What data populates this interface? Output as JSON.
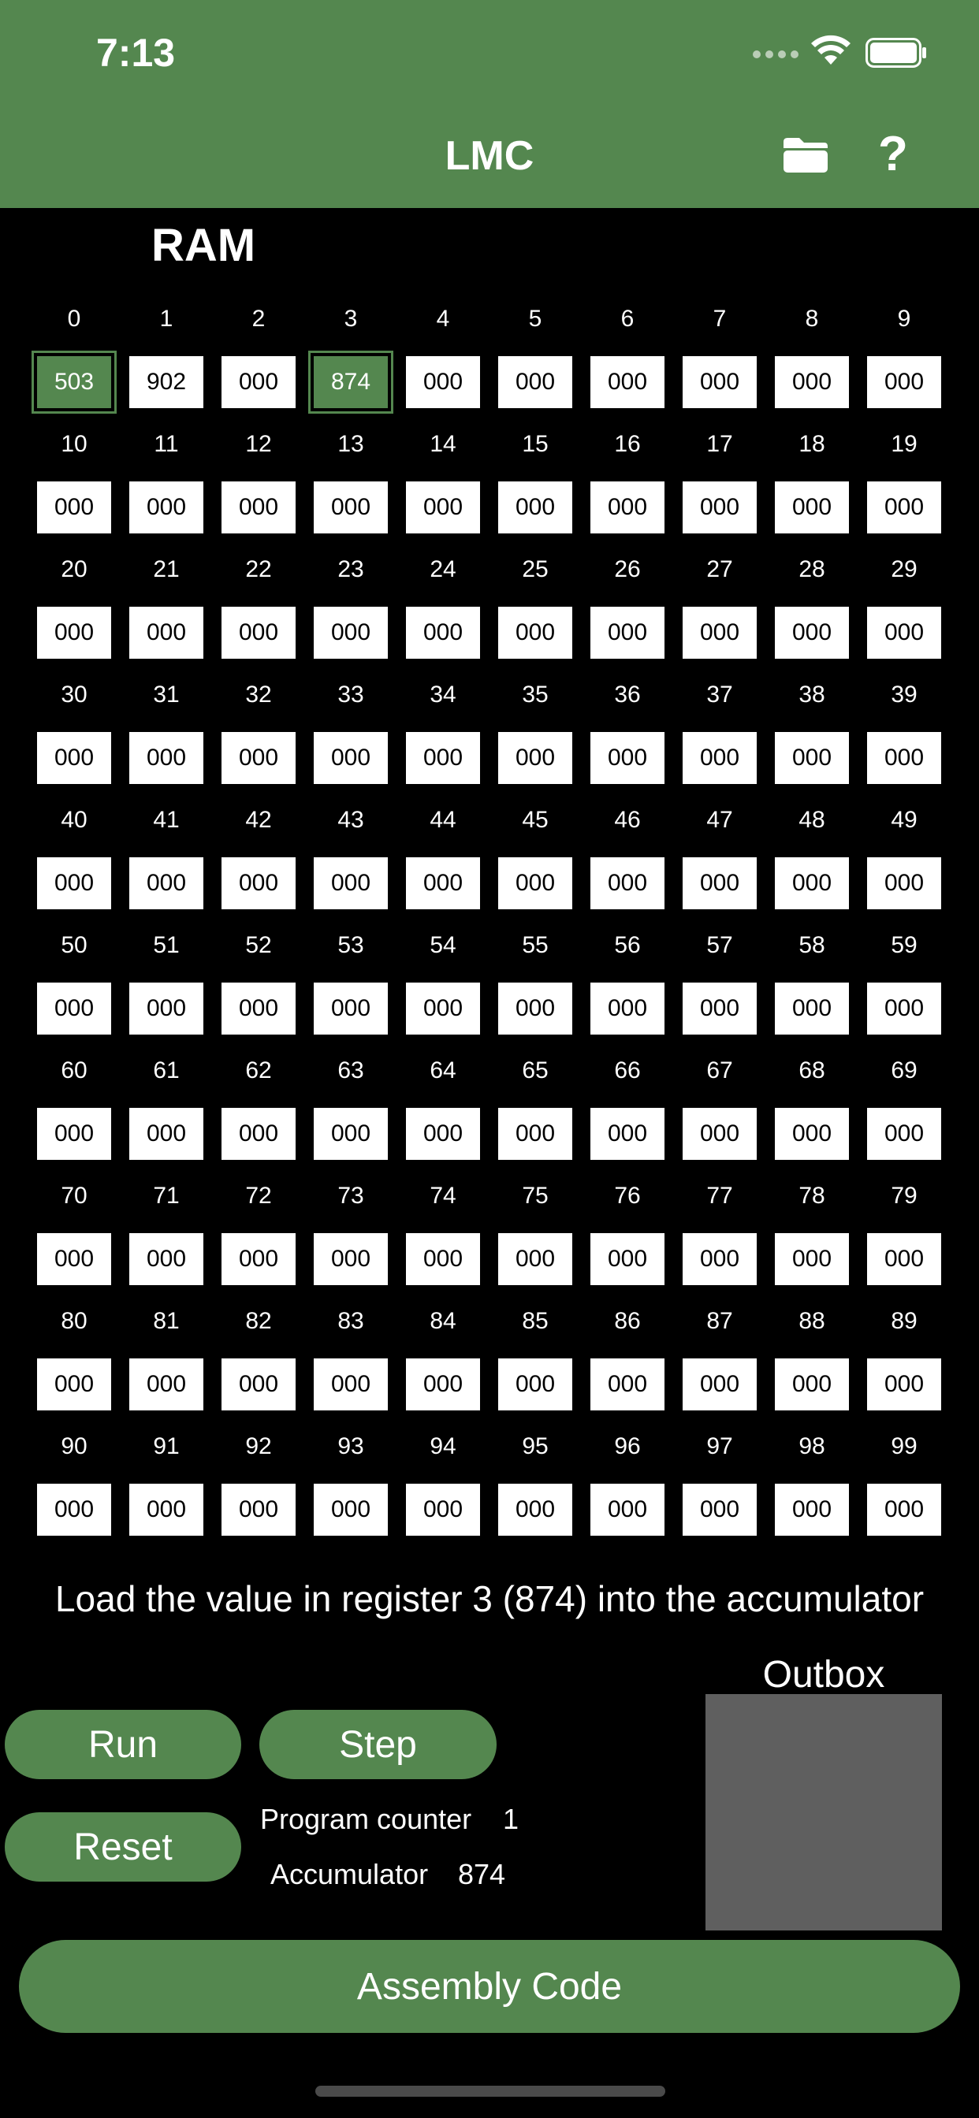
{
  "status_bar": {
    "time": "7:13"
  },
  "nav": {
    "title": "LMC",
    "help": "?"
  },
  "ram": {
    "title": "RAM",
    "cells": [
      {
        "addr": "0",
        "value": "503",
        "active": true
      },
      {
        "addr": "1",
        "value": "902",
        "active": false
      },
      {
        "addr": "2",
        "value": "000",
        "active": false
      },
      {
        "addr": "3",
        "value": "874",
        "active": true
      },
      {
        "addr": "4",
        "value": "000",
        "active": false
      },
      {
        "addr": "5",
        "value": "000",
        "active": false
      },
      {
        "addr": "6",
        "value": "000",
        "active": false
      },
      {
        "addr": "7",
        "value": "000",
        "active": false
      },
      {
        "addr": "8",
        "value": "000",
        "active": false
      },
      {
        "addr": "9",
        "value": "000",
        "active": false
      },
      {
        "addr": "10",
        "value": "000",
        "active": false
      },
      {
        "addr": "11",
        "value": "000",
        "active": false
      },
      {
        "addr": "12",
        "value": "000",
        "active": false
      },
      {
        "addr": "13",
        "value": "000",
        "active": false
      },
      {
        "addr": "14",
        "value": "000",
        "active": false
      },
      {
        "addr": "15",
        "value": "000",
        "active": false
      },
      {
        "addr": "16",
        "value": "000",
        "active": false
      },
      {
        "addr": "17",
        "value": "000",
        "active": false
      },
      {
        "addr": "18",
        "value": "000",
        "active": false
      },
      {
        "addr": "19",
        "value": "000",
        "active": false
      },
      {
        "addr": "20",
        "value": "000",
        "active": false
      },
      {
        "addr": "21",
        "value": "000",
        "active": false
      },
      {
        "addr": "22",
        "value": "000",
        "active": false
      },
      {
        "addr": "23",
        "value": "000",
        "active": false
      },
      {
        "addr": "24",
        "value": "000",
        "active": false
      },
      {
        "addr": "25",
        "value": "000",
        "active": false
      },
      {
        "addr": "26",
        "value": "000",
        "active": false
      },
      {
        "addr": "27",
        "value": "000",
        "active": false
      },
      {
        "addr": "28",
        "value": "000",
        "active": false
      },
      {
        "addr": "29",
        "value": "000",
        "active": false
      },
      {
        "addr": "30",
        "value": "000",
        "active": false
      },
      {
        "addr": "31",
        "value": "000",
        "active": false
      },
      {
        "addr": "32",
        "value": "000",
        "active": false
      },
      {
        "addr": "33",
        "value": "000",
        "active": false
      },
      {
        "addr": "34",
        "value": "000",
        "active": false
      },
      {
        "addr": "35",
        "value": "000",
        "active": false
      },
      {
        "addr": "36",
        "value": "000",
        "active": false
      },
      {
        "addr": "37",
        "value": "000",
        "active": false
      },
      {
        "addr": "38",
        "value": "000",
        "active": false
      },
      {
        "addr": "39",
        "value": "000",
        "active": false
      },
      {
        "addr": "40",
        "value": "000",
        "active": false
      },
      {
        "addr": "41",
        "value": "000",
        "active": false
      },
      {
        "addr": "42",
        "value": "000",
        "active": false
      },
      {
        "addr": "43",
        "value": "000",
        "active": false
      },
      {
        "addr": "44",
        "value": "000",
        "active": false
      },
      {
        "addr": "45",
        "value": "000",
        "active": false
      },
      {
        "addr": "46",
        "value": "000",
        "active": false
      },
      {
        "addr": "47",
        "value": "000",
        "active": false
      },
      {
        "addr": "48",
        "value": "000",
        "active": false
      },
      {
        "addr": "49",
        "value": "000",
        "active": false
      },
      {
        "addr": "50",
        "value": "000",
        "active": false
      },
      {
        "addr": "51",
        "value": "000",
        "active": false
      },
      {
        "addr": "52",
        "value": "000",
        "active": false
      },
      {
        "addr": "53",
        "value": "000",
        "active": false
      },
      {
        "addr": "54",
        "value": "000",
        "active": false
      },
      {
        "addr": "55",
        "value": "000",
        "active": false
      },
      {
        "addr": "56",
        "value": "000",
        "active": false
      },
      {
        "addr": "57",
        "value": "000",
        "active": false
      },
      {
        "addr": "58",
        "value": "000",
        "active": false
      },
      {
        "addr": "59",
        "value": "000",
        "active": false
      },
      {
        "addr": "60",
        "value": "000",
        "active": false
      },
      {
        "addr": "61",
        "value": "000",
        "active": false
      },
      {
        "addr": "62",
        "value": "000",
        "active": false
      },
      {
        "addr": "63",
        "value": "000",
        "active": false
      },
      {
        "addr": "64",
        "value": "000",
        "active": false
      },
      {
        "addr": "65",
        "value": "000",
        "active": false
      },
      {
        "addr": "66",
        "value": "000",
        "active": false
      },
      {
        "addr": "67",
        "value": "000",
        "active": false
      },
      {
        "addr": "68",
        "value": "000",
        "active": false
      },
      {
        "addr": "69",
        "value": "000",
        "active": false
      },
      {
        "addr": "70",
        "value": "000",
        "active": false
      },
      {
        "addr": "71",
        "value": "000",
        "active": false
      },
      {
        "addr": "72",
        "value": "000",
        "active": false
      },
      {
        "addr": "73",
        "value": "000",
        "active": false
      },
      {
        "addr": "74",
        "value": "000",
        "active": false
      },
      {
        "addr": "75",
        "value": "000",
        "active": false
      },
      {
        "addr": "76",
        "value": "000",
        "active": false
      },
      {
        "addr": "77",
        "value": "000",
        "active": false
      },
      {
        "addr": "78",
        "value": "000",
        "active": false
      },
      {
        "addr": "79",
        "value": "000",
        "active": false
      },
      {
        "addr": "80",
        "value": "000",
        "active": false
      },
      {
        "addr": "81",
        "value": "000",
        "active": false
      },
      {
        "addr": "82",
        "value": "000",
        "active": false
      },
      {
        "addr": "83",
        "value": "000",
        "active": false
      },
      {
        "addr": "84",
        "value": "000",
        "active": false
      },
      {
        "addr": "85",
        "value": "000",
        "active": false
      },
      {
        "addr": "86",
        "value": "000",
        "active": false
      },
      {
        "addr": "87",
        "value": "000",
        "active": false
      },
      {
        "addr": "88",
        "value": "000",
        "active": false
      },
      {
        "addr": "89",
        "value": "000",
        "active": false
      },
      {
        "addr": "90",
        "value": "000",
        "active": false
      },
      {
        "addr": "91",
        "value": "000",
        "active": false
      },
      {
        "addr": "92",
        "value": "000",
        "active": false
      },
      {
        "addr": "93",
        "value": "000",
        "active": false
      },
      {
        "addr": "94",
        "value": "000",
        "active": false
      },
      {
        "addr": "95",
        "value": "000",
        "active": false
      },
      {
        "addr": "96",
        "value": "000",
        "active": false
      },
      {
        "addr": "97",
        "value": "000",
        "active": false
      },
      {
        "addr": "98",
        "value": "000",
        "active": false
      },
      {
        "addr": "99",
        "value": "000",
        "active": false
      }
    ]
  },
  "description": "Load the value in register 3 (874) into the accumulator",
  "controls": {
    "run": "Run",
    "step": "Step",
    "reset": "Reset",
    "program_counter_label": "Program counter",
    "program_counter_value": "1",
    "accumulator_label": "Accumulator",
    "accumulator_value": "874",
    "outbox_label": "Outbox",
    "assembly_code": "Assembly Code"
  },
  "colors": {
    "accent": "#54874F",
    "background": "#000000",
    "outbox": "#5F5F5F"
  },
  "icons": [
    "wifi-icon",
    "battery-icon",
    "folder-icon",
    "help-icon"
  ]
}
